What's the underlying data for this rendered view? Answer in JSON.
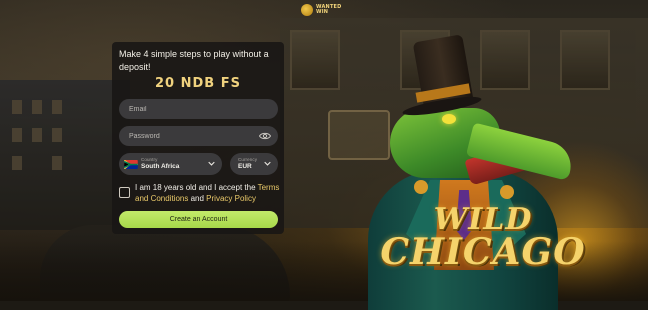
{
  "logo": {
    "text": "WANTED WIN"
  },
  "form": {
    "heading": "Make 4 simple steps to play without a deposit!",
    "promo": "20 NDB FS",
    "email_placeholder": "Email",
    "password_placeholder": "Password",
    "country_label": "Country",
    "country_value": "South Africa",
    "currency_label": "Currency",
    "currency_value": "EUR",
    "terms_prefix": "I am 18 years old and I accept the ",
    "terms_link": "Terms and Conditions",
    "terms_and": " and ",
    "privacy_link": "Privacy Policy",
    "submit_label": "Create an Account"
  },
  "game": {
    "title_line1": "WILD",
    "title_line2": "CHICAGO"
  },
  "colors": {
    "accent_green": "#b4e05a",
    "gold": "#f0d27e",
    "panel_bg": "#181614",
    "field_bg": "#3b3a3c"
  },
  "icons": [
    "logo-badge-icon",
    "eye-icon",
    "south-africa-flag-icon",
    "chevron-down-icon"
  ]
}
